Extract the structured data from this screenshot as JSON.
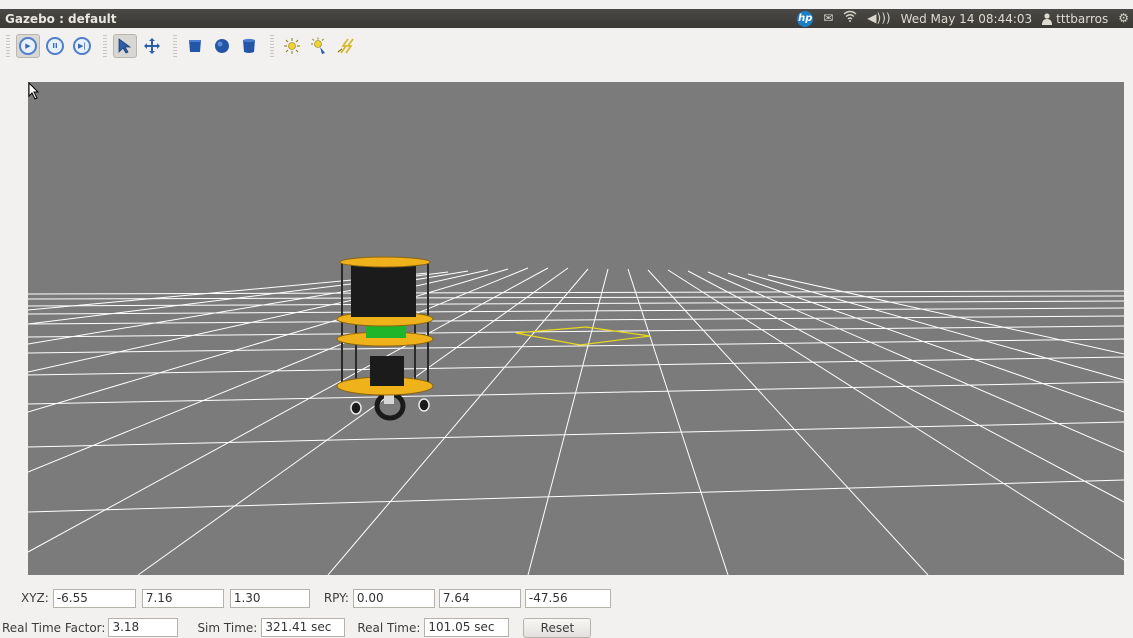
{
  "window": {
    "title": "Gazebo : default"
  },
  "tray": {
    "hp_label": "hp",
    "clock": "Wed May 14 08:44:03",
    "username": "tttbarros",
    "icons": [
      "hp-icon",
      "mail-icon",
      "wifi-icon",
      "volume-icon",
      "user-icon",
      "power-gear-icon"
    ]
  },
  "toolbar": {
    "icons": [
      "play-icon",
      "pause-icon",
      "step-icon",
      "select-arrow-icon",
      "translate-icon",
      "box-shape-icon",
      "sphere-shape-icon",
      "cylinder-shape-icon",
      "point-light-icon",
      "spot-light-icon",
      "directional-light-icon"
    ]
  },
  "pose": {
    "xyz_label": "XYZ:",
    "x": "-6.55",
    "y": "7.16",
    "z": "1.30",
    "rpy_label": "RPY:",
    "roll": "0.00",
    "pitch": "7.64",
    "yaw": "-47.56"
  },
  "time": {
    "rtf_label": "Real Time Factor:",
    "rtf": "3.18",
    "sim_label": "Sim Time:",
    "sim": "321.41 sec",
    "real_label": "Real Time:",
    "real": "101.05 sec",
    "reset_label": "Reset"
  },
  "colors": {
    "viewport_bg": "#7b7b7b",
    "grid": "#ffffff",
    "robot_plate": "#f0b21a",
    "robot_green": "#1fb52a",
    "selection": "#e8d81c"
  }
}
